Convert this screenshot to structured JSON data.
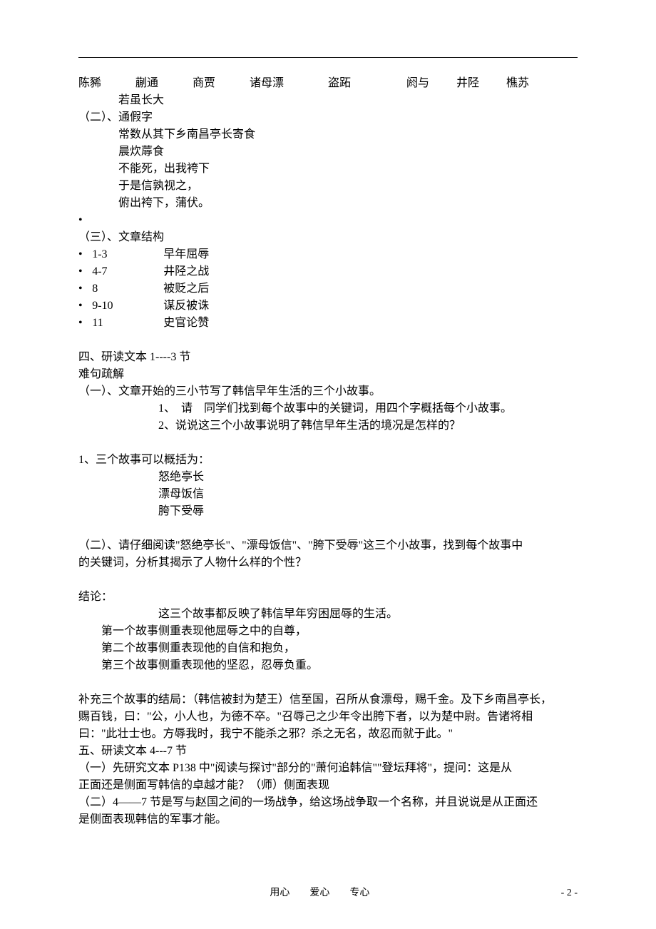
{
  "line1": {
    "a": "陈豨",
    "b": "蒯通",
    "c": "商贾",
    "d": "诸母漂",
    "e": "盗跖",
    "f": "阏与",
    "g": "井陉",
    "h": "樵苏"
  },
  "line2_indent": "若虽长大",
  "sec2_title": "（二）、通假字",
  "sec2_items": [
    "常数从其下乡南昌亭长寄食",
    "晨炊蓐食",
    "不能死，出我袴下",
    "于是信孰视之，",
    "俯出袴下，蒲伏。"
  ],
  "lone_bullet": "•",
  "sec3_title": "（三）、文章结构",
  "sec3_items": [
    {
      "b": "•",
      "n": "1-3",
      "t": "早年屈辱"
    },
    {
      "b": "•",
      "n": "4-7",
      "t": "井陉之战"
    },
    {
      "b": "•",
      "n": "8",
      "t": "被贬之后"
    },
    {
      "b": "•",
      "n": "9-10",
      "t": "谋反被诛"
    },
    {
      "b": "•",
      "n": "11",
      "t": "史官论赞"
    }
  ],
  "sec4_title": "四、研读文本 1----3 节",
  "sec4_sub": "难句疏解",
  "sec4_p1": "（一）、文章开始的三小节写了韩信早年生活的三个小故事。",
  "sec4_p1a": "1、　请　同学们找到每个故事中的关键词，用四个字概括每个小故事。",
  "sec4_p1b": "2、说说这三个小故事说明了韩信早年生活的境况是怎样的？",
  "sec4_p2": "1、三个故事可以概括为：",
  "sec4_p2_items": [
    "怒绝亭长",
    "漂母饭信",
    "胯下受辱"
  ],
  "sec4_p3a": "（二）、请仔细阅读\"怒绝亭长\"、\"漂母饭信\"、\"胯下受辱\"这三个小故事，找到每个故事中",
  "sec4_p3b": "的关键词，分析其揭示了人物什么样的个性？",
  "conclusion_label": "结论：",
  "conclusion_center": "这三个故事都反映了韩信早年穷困屈辱的生活。",
  "conclusion_items": [
    "第一个故事侧重表现他屈辱之中的自尊，",
    "第二个故事侧重表现他的自信和抱负，",
    "第三个故事侧重表现他的坚忍，忍辱负重。"
  ],
  "supp_a": "补充三个故事的结局：（韩信被封为楚王）信至国，召所从食漂母，赐千金。及下乡南昌亭长，",
  "supp_b": "赐百钱，曰：\"公，小人也，为德不卒。\"召辱己之少年令出胯下者，以为楚中尉。告诸将相",
  "supp_c": "曰：\"此壮士也。方辱我时，我宁不能杀之邪？杀之无名，故忍而就于此。\"",
  "sec5_title": "五、研读文本 4---7 节",
  "sec5_p1a": "（一）先研究文本 P138 中\"阅读与探讨\"部分的\"萧何追韩信\"\"登坛拜将\"，提问：这是从",
  "sec5_p1b": "正面还是侧面写韩信的卓越才能？（师）侧面表现",
  "sec5_p2a": "（二）4——7 节是写与赵国之间的一场战争，给这场战争取一个名称，并且说说是从正面还",
  "sec5_p2b": "是侧面表现韩信的军事才能。",
  "footer_center": "用心　　爱心　　专心",
  "footer_right": "- 2 -"
}
